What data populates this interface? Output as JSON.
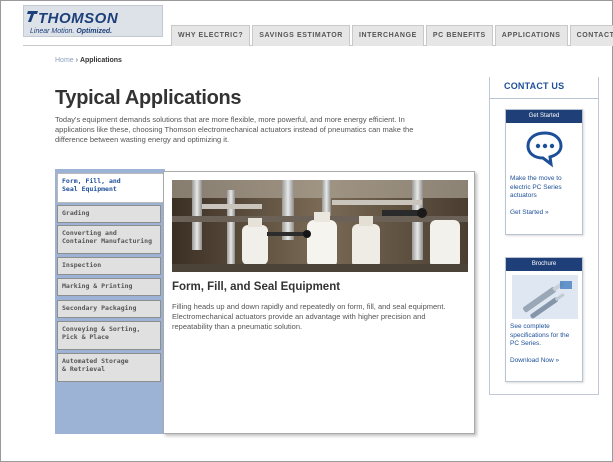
{
  "brand": {
    "name": "THOMSON",
    "tagline_regular": "Linear Motion.",
    "tagline_bold": "Optimized."
  },
  "nav": {
    "items": [
      {
        "label": "WHY ELECTRIC?"
      },
      {
        "label": "SAVINGS ESTIMATOR"
      },
      {
        "label": "INTERCHANGE"
      },
      {
        "label": "PC BENEFITS"
      },
      {
        "label": "APPLICATIONS"
      },
      {
        "label": "CONTACT US"
      }
    ]
  },
  "breadcrumb": {
    "home": "Home",
    "separator": "›",
    "current": "Applications"
  },
  "page": {
    "title": "Typical Applications",
    "intro": "Today's equipment demands solutions that are more flexible, more powerful, and more energy efficient. In applications like these, choosing Thomson electromechanical actuators instead of pneumatics can make the difference between wasting energy and optimizing it."
  },
  "tabs": {
    "items": [
      {
        "line1": "Form, Fill, and",
        "line2": "Seal Equipment"
      },
      {
        "line1": "Grading",
        "line2": ""
      },
      {
        "line1": "Converting and",
        "line2": "Container Manufacturing"
      },
      {
        "line1": "Inspection",
        "line2": ""
      },
      {
        "line1": "Marking & Printing",
        "line2": ""
      },
      {
        "line1": "Secondary Packaging",
        "line2": ""
      },
      {
        "line1": "Conveying & Sorting,",
        "line2": "Pick & Place"
      },
      {
        "line1": "Automated Storage",
        "line2": "& Retrieval"
      }
    ],
    "active_index": 0
  },
  "content": {
    "title": "Form, Fill, and Seal Equipment",
    "text": "Filling heads up and down rapidly and repeatedly on form, fill, and seal equipment. Electromechanical actuators provide an advantage with higher precision and repeatability than a pneumatic solution."
  },
  "sidebar": {
    "title": "CONTACT US",
    "cards": [
      {
        "header": "Get Started",
        "text": "Make the move to electric PC Series actuators",
        "link": "Get Started »",
        "icon": "chat-bubble-icon"
      },
      {
        "header": "Brochure",
        "text": "See complete specifications for the PC Series.",
        "link": "Download Now »",
        "icon": "brochure-image"
      }
    ]
  },
  "colors": {
    "brand_blue": "#1d4f98",
    "card_header": "#1e3f77",
    "tab_column": "#9cb3d5",
    "nav_tab": "#e6e6e6"
  }
}
